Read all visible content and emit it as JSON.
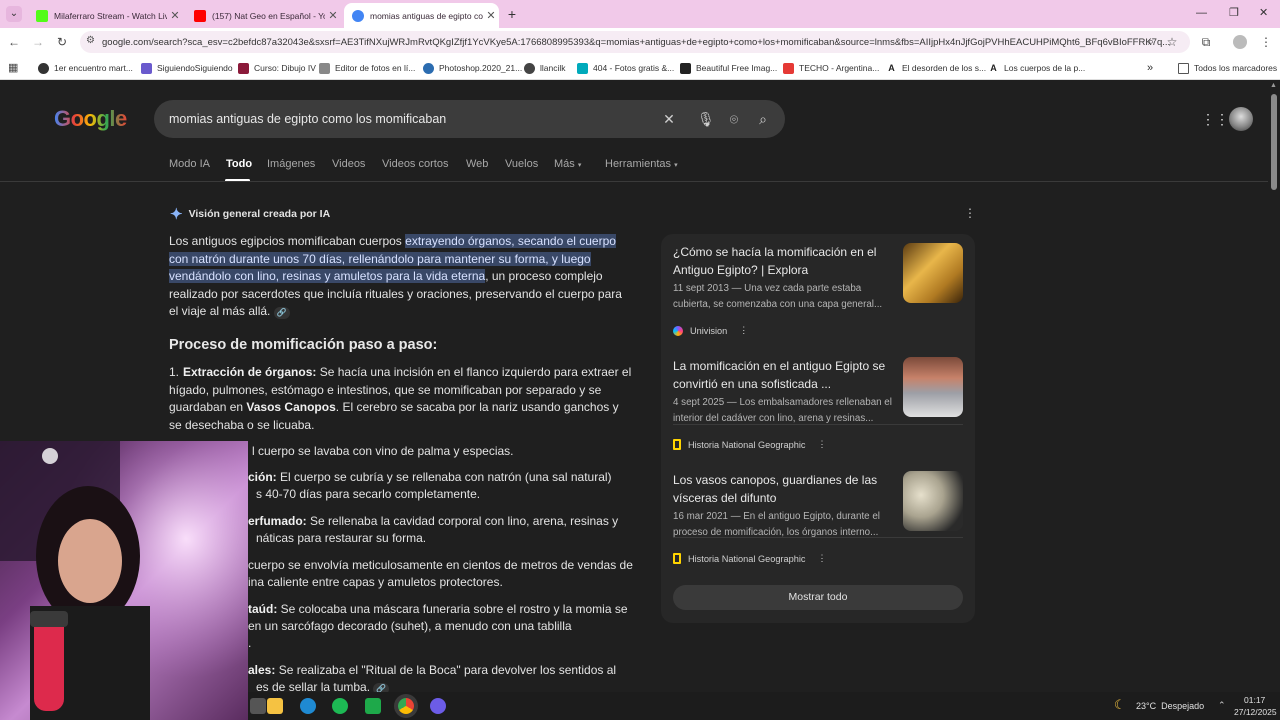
{
  "tabs": [
    {
      "title": "Milaferraro Stream - Watch Live",
      "favicon_color": "#53fc18"
    },
    {
      "title": "(157) Nat Geo en Español - YouTube",
      "favicon_color": "#ff0000"
    },
    {
      "title": "momias antiguas de egipto como",
      "favicon_color": "#4285f4"
    }
  ],
  "new_tab_icon": "plus-icon",
  "address": "google.com/search?sca_esv=c2befdc87a32043e&sxsrf=AE3TifNXujWRJmRvtQKgIZfjf1YcVKye5A:1766808995393&q=momias+antiguas+de+egipto+como+los+momificaban&source=lnms&fbs=AIIjpHx4nJjfGojPVHhEACUHPiMQht6_BFq6vBIoFFRK7q...",
  "bookmarks": [
    {
      "label": "1er encuentro mart...",
      "color": "#333333"
    },
    {
      "label": "SiguiendoSiguiendo",
      "color": "#6a5acd"
    },
    {
      "label": "Curso: Dibujo IV",
      "color": "#8b1a3a"
    },
    {
      "label": "Editor de fotos en lí...",
      "color": "#888888"
    },
    {
      "label": "Photoshop.2020_21...",
      "color": "#2b6cb0"
    },
    {
      "label": "llancilk",
      "color": "#444444"
    },
    {
      "label": "404 - Fotos gratis &...",
      "color": "#0ab"
    },
    {
      "label": "Beautiful Free Imag...",
      "color": "#222222"
    },
    {
      "label": "TECHO - Argentina...",
      "color": "#e53935"
    },
    {
      "label": "El desorden de los s...",
      "color": "#222222"
    },
    {
      "label": "Los cuerpos de la p...",
      "color": "#222222"
    }
  ],
  "bookmarks_more": "»",
  "bookmarks_all": "Todos los marcadores",
  "logo": "Google",
  "query": "momias antiguas de egipto como los momificaban",
  "nav": [
    "Modo IA",
    "Todo",
    "Imágenes",
    "Videos",
    "Videos cortos",
    "Web",
    "Vuelos",
    "Más",
    "Herramientas"
  ],
  "ai_overview": {
    "header": "Visión general creada por IA",
    "intro_pre": "Los antiguos egipcios momificaban cuerpos ",
    "intro_hl": "extrayendo órganos, secando el cuerpo con natrón durante unos 70 días, rellenándolo para mantener su forma, y luego vendándolo con lino, resinas y amuletos para la vida eterna",
    "intro_post": ", un proceso complejo realizado por sacerdotes que incluía rituales y oraciones, preservando el cuerpo para el viaje al más allá.",
    "section_title": "Proceso de momificación paso a paso:",
    "steps": [
      {
        "n": "1.",
        "bold": "Extracción de órganos:",
        "text": " Se hacía una incisión en el flanco izquierdo para extraer el hígado, pulmones, estómago e intestinos, que se momificaban por separado y se guardaban en ",
        "bold2": "Vasos Canopos",
        "text2": ". El cerebro se sacaba por la nariz usando ganchos y se desechaba o se licuaba."
      },
      {
        "bold": "",
        "text": "l cuerpo se lavaba con vino de palma y especias."
      },
      {
        "bold": "ción:",
        "text": " El cuerpo se cubría y se rellenaba con natrón (una sal natural)",
        "line2": "s 40-70 días para secarlo completamente."
      },
      {
        "bold": "erfumado:",
        "text": " Se rellenaba la cavidad corporal con lino, arena, resinas y",
        "line2": "náticas para restaurar su forma."
      },
      {
        "bold": "",
        "text": "cuerpo se envolvía meticulosamente en cientos de metros de vendas de",
        "line2": "ina caliente entre capas y amuletos protectores."
      },
      {
        "bold": "taúd:",
        "text": " Se colocaba una máscara funeraria sobre el rostro y la momia se",
        "line2": "en un sarcófago decorado (suhet), a menudo con una tablilla",
        "line3": "."
      },
      {
        "bold": "ales:",
        "text": " Se realizaba el \"Ritual de la Boca\" para devolver los sentidos al",
        "line2": "es de sellar la tumba."
      }
    ]
  },
  "sources": [
    {
      "title": "¿Cómo se hacía la momificación en el Antiguo Egipto? | Explora",
      "desc": "11 sept 2013 — Una vez cada parte estaba cubierta, se comenzaba con una capa general...",
      "site": "Univision",
      "site_color": "#7b5cff",
      "thumb_color": "#c8902a"
    },
    {
      "title": "La momificación en el antiguo Egipto se convirtió en una sofisticada ...",
      "desc": "4 sept 2025 — Los embalsamadores rellenaban el interior del cadáver con lino, arena y resinas...",
      "site": "Historia National Geographic",
      "site_color": "#ffd400",
      "thumb_color": "#b06a55"
    },
    {
      "title": "Los vasos canopos, guardianes de las vísceras del difunto",
      "desc": "16 mar 2021 — En el antiguo Egipto, durante el proceso de momificación, los órganos interno...",
      "site": "Historia National Geographic",
      "site_color": "#ffd400",
      "thumb_color": "#cfcab8"
    }
  ],
  "show_all": "Mostrar todo",
  "weather": "23°C  Despejado",
  "clock": {
    "time": "01:17",
    "date": "27/12/2025"
  }
}
